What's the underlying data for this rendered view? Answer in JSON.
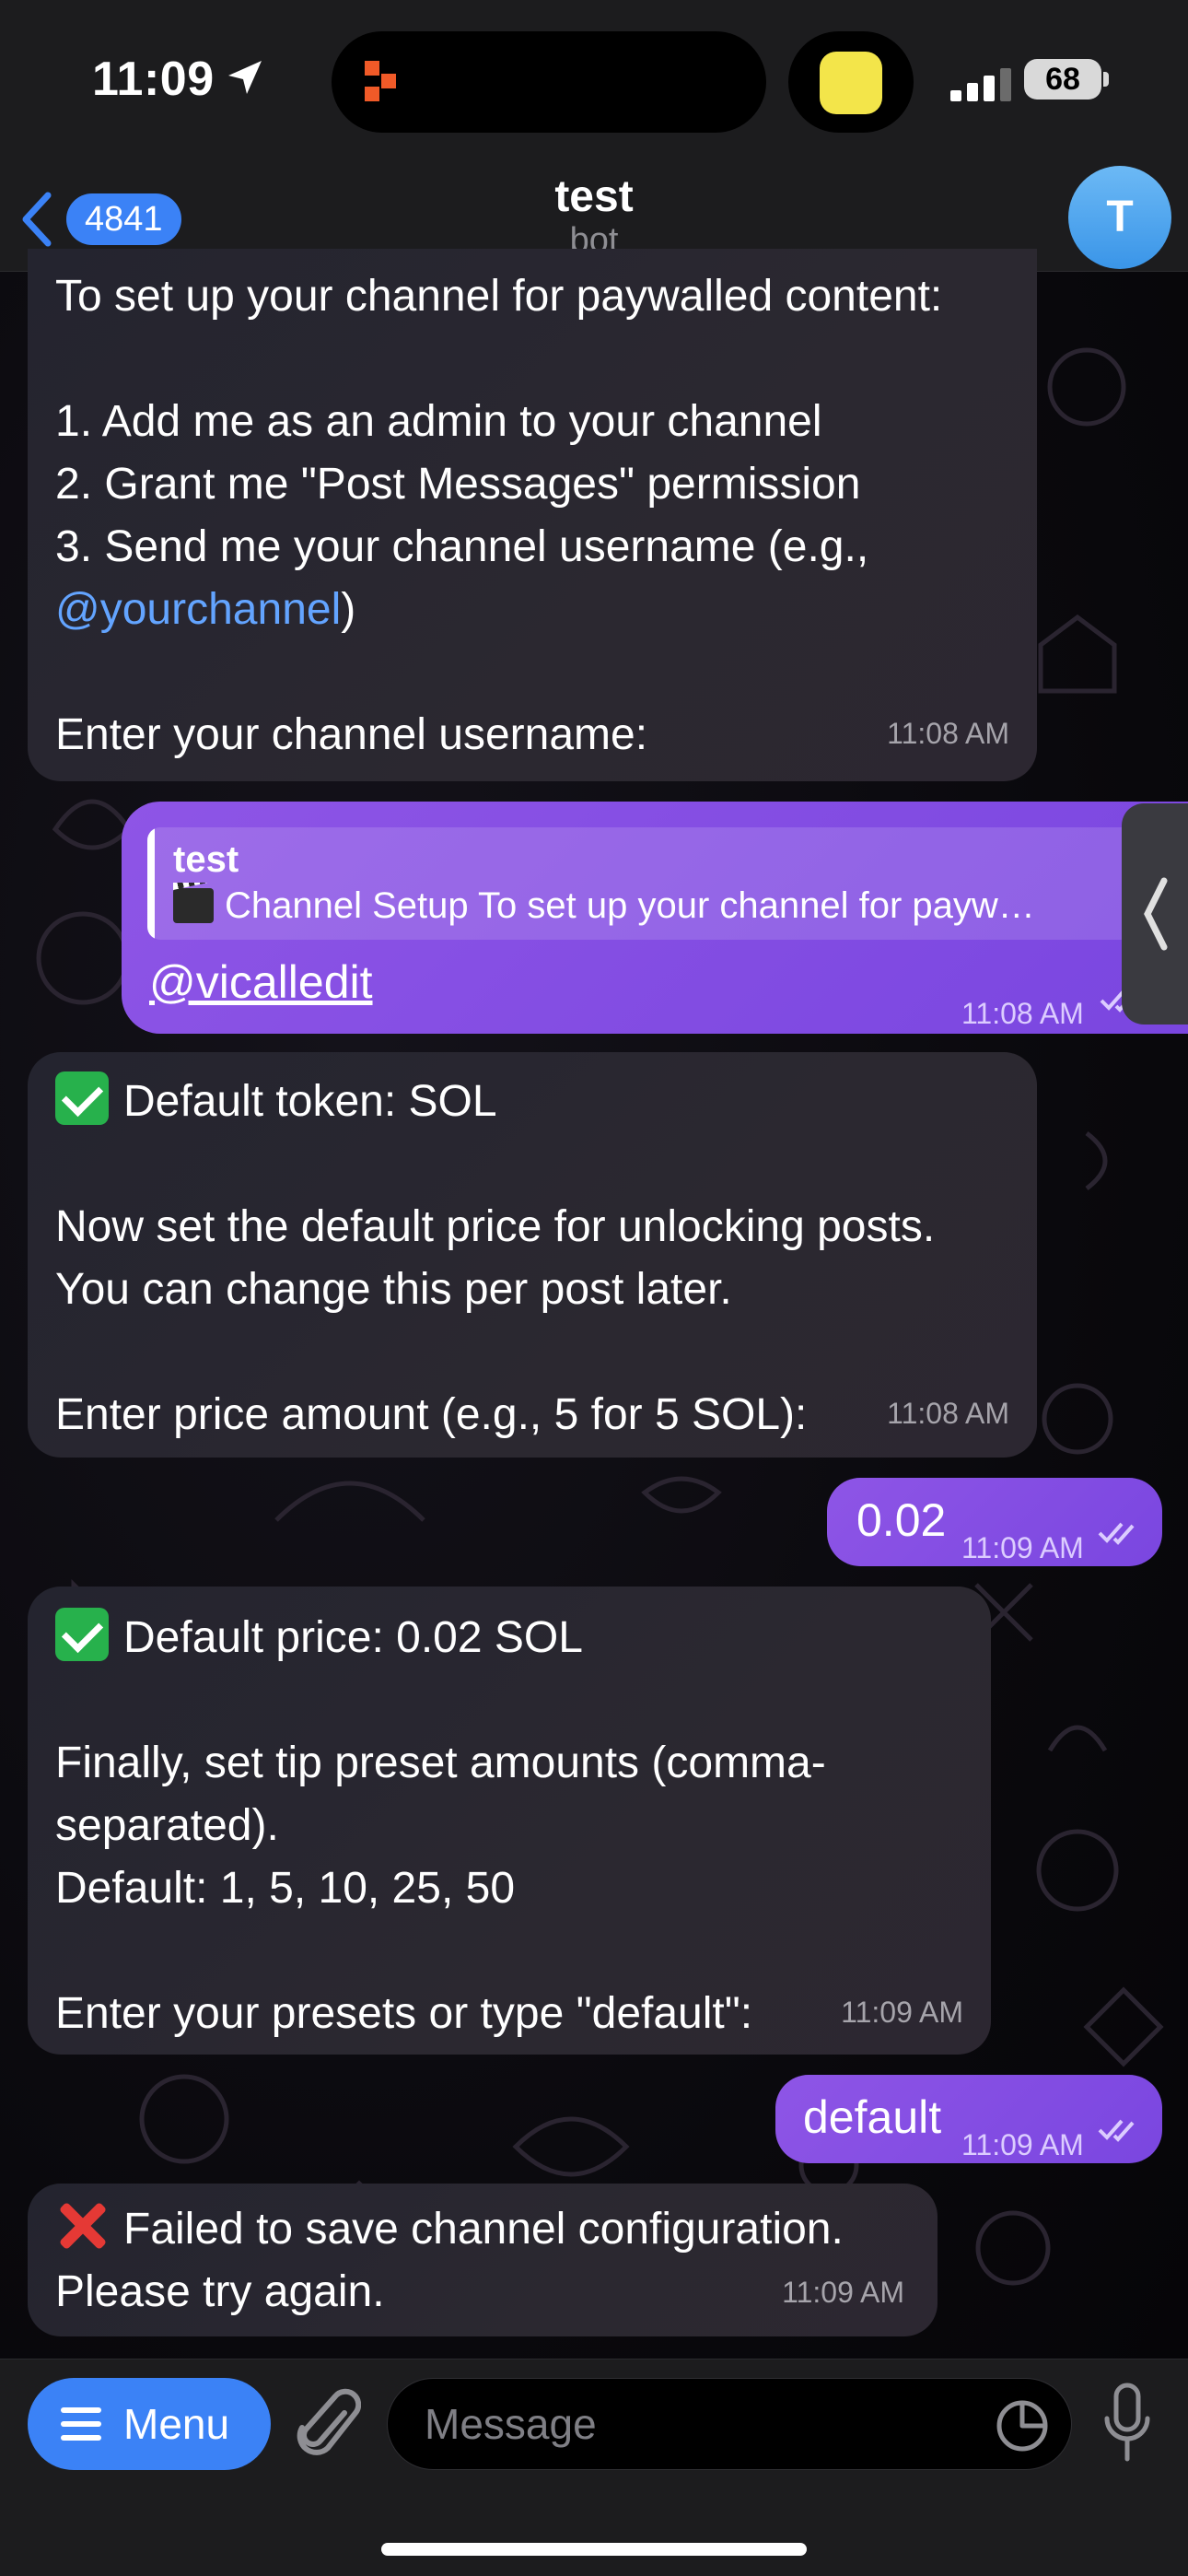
{
  "status_bar": {
    "time": "11:09",
    "battery": "68"
  },
  "header": {
    "back_count": "4841",
    "title": "test",
    "subtitle": "bot",
    "avatar_letter": "T"
  },
  "messages": [
    {
      "direction": "in",
      "lines": [
        "To set up your channel for paywalled content:",
        "",
        "1. Add me as an admin to your channel",
        "2. Grant me \"Post Messages\" permission",
        "3. Send me your channel username (e.g.,",
        "@yourchannel)",
        "",
        "Enter your channel username:"
      ],
      "link_text": "@yourchannel",
      "time": "11:08 AM"
    },
    {
      "direction": "out",
      "reply_to": {
        "name": "test",
        "text": "Channel Setup To set up your channel for payw…"
      },
      "text": "@vicalledit",
      "time": "11:08 AM"
    },
    {
      "direction": "in",
      "first_line": "Default token: SOL",
      "lines": [
        "",
        "Now set the default price for unlocking posts.",
        "You can change this per post later.",
        "",
        "Enter price amount (e.g., 5 for 5 SOL):"
      ],
      "time": "11:08 AM"
    },
    {
      "direction": "out",
      "text": "0.02",
      "time": "11:09 AM"
    },
    {
      "direction": "in",
      "first_line": "Default price: 0.02 SOL",
      "lines": [
        "",
        "Finally, set tip preset amounts (comma-",
        "separated).",
        "Default: 1, 5, 10, 25, 50",
        "",
        "Enter your presets or type \"default\":"
      ],
      "time": "11:09 AM"
    },
    {
      "direction": "out",
      "text": "default",
      "time": "11:09 AM"
    },
    {
      "direction": "in",
      "first_line": "Failed to save channel configuration.",
      "lines": [
        "Please try again."
      ],
      "time": "11:09 AM"
    }
  ],
  "input_bar": {
    "menu_label": "Menu",
    "placeholder": "Message"
  },
  "icons": {
    "back": "chevron-left-icon",
    "attach": "paperclip-icon",
    "sticker": "sticker-icon",
    "mic": "microphone-icon",
    "menu": "hamburger-icon"
  },
  "colors": {
    "accent": "#3b82f6",
    "outgoing_bubble": "#8452e4",
    "incoming_bubble": "#28262e",
    "link": "#63a4ff"
  }
}
